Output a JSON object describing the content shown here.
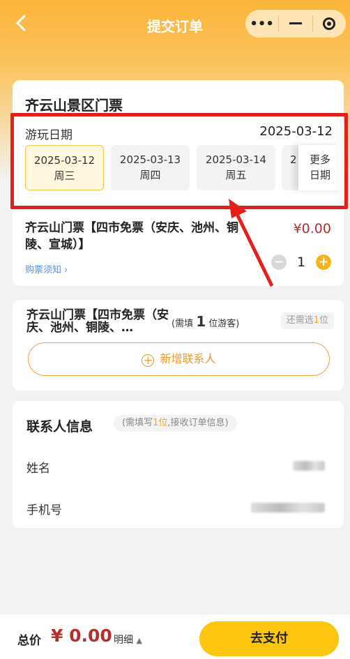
{
  "nav": {
    "back_icon": "chevron-left-icon",
    "title": "提交订单",
    "capsule_icons": [
      "more-dots-icon",
      "minimize-icon",
      "target-icon"
    ]
  },
  "ticket": {
    "title": "齐云山景区门票",
    "date_label": "游玩日期",
    "selected_date": "2025-03-12",
    "dates": [
      {
        "date": "2025-03-12",
        "weekday": "周三",
        "selected": true
      },
      {
        "date": "2025-03-13",
        "weekday": "周四",
        "selected": false
      },
      {
        "date": "2025-03-14",
        "weekday": "周五",
        "selected": false
      }
    ],
    "peek_char": "2",
    "more_dates": [
      "更多",
      "日期"
    ],
    "product_name": "齐云山门票【四市免票（安庆、池州、铜陵、宣城）】",
    "price": "¥0.00",
    "notice": "购票须知",
    "quantity": "1"
  },
  "visitors": {
    "ticket_name": "齐云山门票【四市免票（安庆、池州、铜陵、…",
    "need_prefix": "(需填",
    "need_count": "1",
    "need_suffix": "位游客)",
    "remaining_prefix": "还需选",
    "remaining_count": "1",
    "remaining_suffix": "位",
    "add_contact": "新增联系人"
  },
  "contact": {
    "title": "联系人信息",
    "hint_prefix": "(需填写",
    "hint_count": "1位",
    "hint_suffix": ",接收订单信息)",
    "name_label": "姓名",
    "phone_label": "手机号"
  },
  "footer": {
    "total_label": "总价",
    "total_amount": "¥ 0.00",
    "detail_label": "明细",
    "pay_button": "去支付"
  },
  "colors": {
    "accent": "#fbc510",
    "price": "#b1312c",
    "highlight_box": "#e3211c"
  }
}
